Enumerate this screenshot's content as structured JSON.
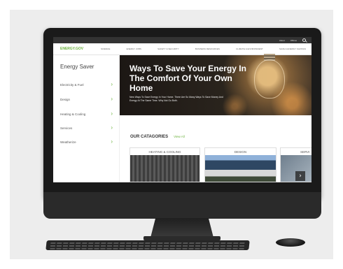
{
  "topbar": {
    "about": "About",
    "offices": "Offices"
  },
  "navbar": {
    "logo": "ENERGY.GOV",
    "links": [
      "Science",
      "Energy Jobs",
      "Safety & Security",
      "Business Resources",
      "Climate & Environment",
      "Save & Energy Savings"
    ]
  },
  "sidebar": {
    "title": "Energy Saver",
    "items": [
      {
        "label": "Electricity & Fuel"
      },
      {
        "label": "Design"
      },
      {
        "label": "Heating & Cooling"
      },
      {
        "label": "Services"
      },
      {
        "label": "Weatherize"
      }
    ]
  },
  "hero": {
    "title": "Ways To Save Your Energy In The Comfort Of Your Own Home",
    "subtitle": "New Ways To Save Energy In Your Home. There Are So Many Ways To Save Money And Energy At The Same Time. Why Not Go Both."
  },
  "categories": {
    "title": "OUR CATAGORIES",
    "view_all": "View All",
    "cards": [
      {
        "label": "Heating & Cooling"
      },
      {
        "label": "Design"
      },
      {
        "label": "Servi"
      }
    ]
  },
  "colors": {
    "accent": "#6db33f",
    "topbar": "#333333"
  },
  "icons": {
    "search": "search-icon",
    "chevron": "chevron-right-icon",
    "next": "next-arrow-icon",
    "apple": "apple-logo-icon"
  }
}
